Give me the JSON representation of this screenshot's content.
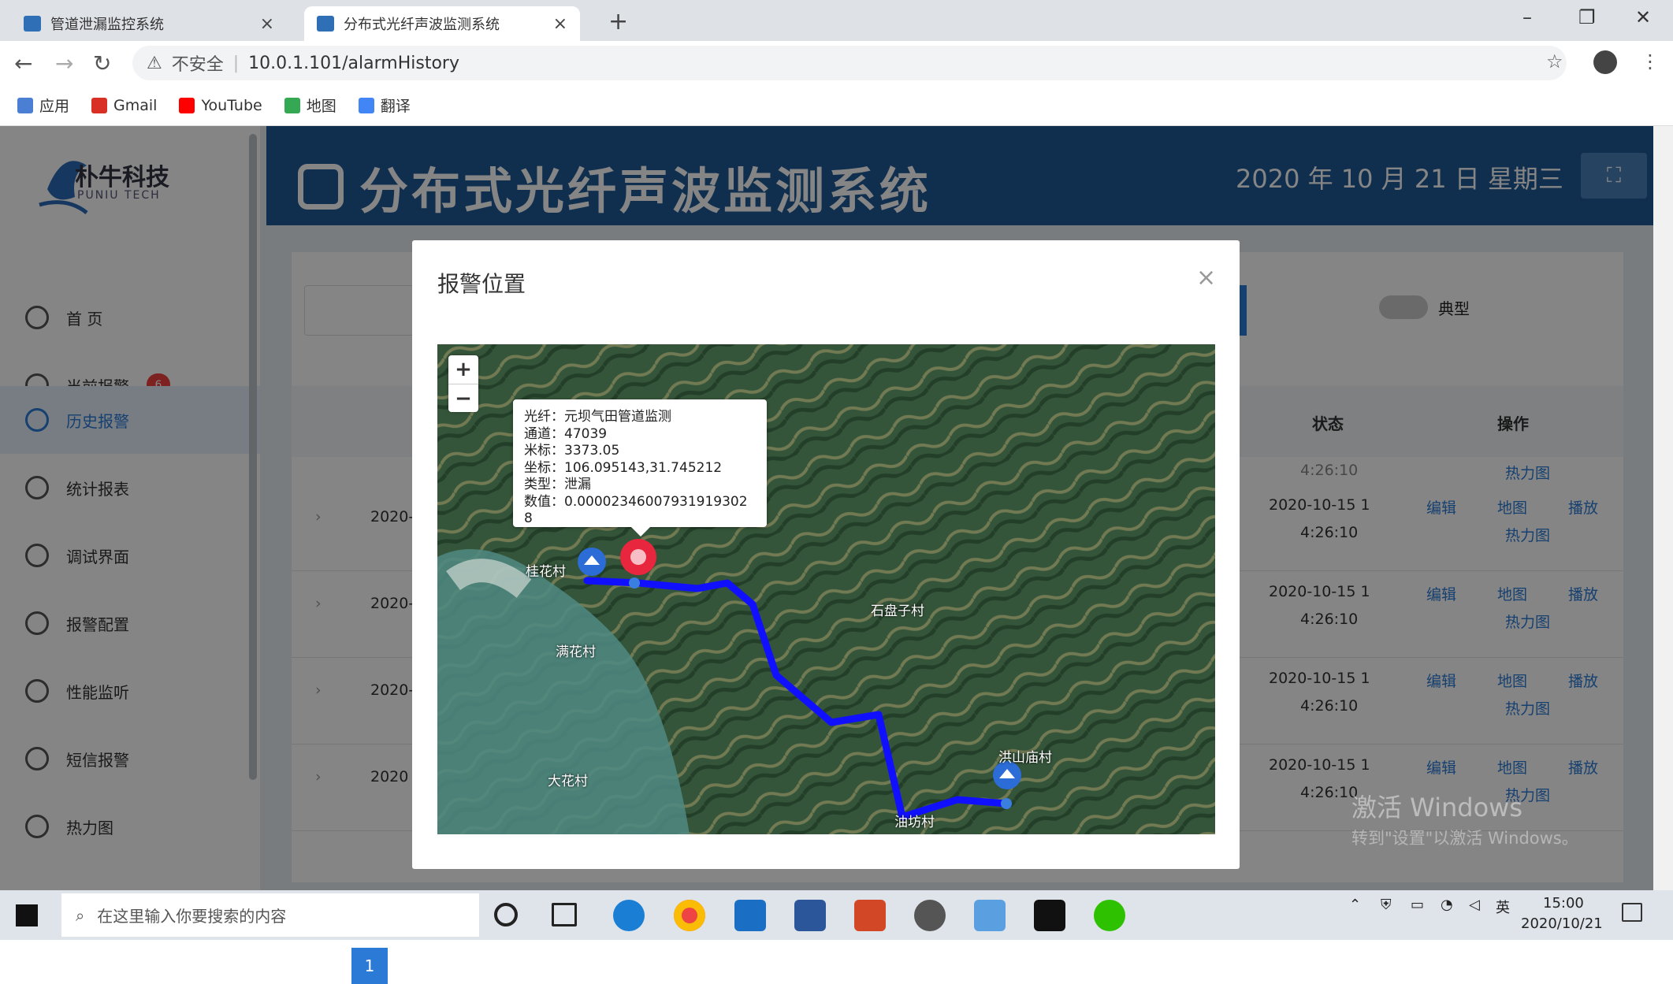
{
  "browser": {
    "tabs": [
      {
        "title": "管道泄漏监控系统",
        "active": false
      },
      {
        "title": "分布式光纤声波监测系统",
        "active": true
      }
    ],
    "insecure_label": "不安全",
    "url": "10.0.1.101/alarmHistory",
    "bookmarks": [
      "应用",
      "Gmail",
      "YouTube",
      "地图",
      "翻译"
    ]
  },
  "app": {
    "logo_name": "朴牛科技",
    "logo_sub": "PUNIU TECH",
    "title": "分布式光纤声波监测系统",
    "date": "2020 年 10 月 21 日 星期三",
    "menu": [
      {
        "label": "首 页",
        "icon": "home-icon"
      },
      {
        "label": "当前报警",
        "icon": "bell-icon",
        "badge": "6"
      },
      {
        "label": "历史报警",
        "icon": "clock-icon",
        "active": true
      },
      {
        "label": "统计报表",
        "icon": "clock-icon"
      },
      {
        "label": "调试界面",
        "icon": "sliders-icon"
      },
      {
        "label": "报警配置",
        "icon": "settings-icon"
      },
      {
        "label": "性能监听",
        "icon": "monitor-icon"
      },
      {
        "label": "短信报警",
        "icon": "mail-icon"
      },
      {
        "label": "热力图",
        "icon": "heatmap-icon"
      }
    ],
    "toggle_label": "典型",
    "table": {
      "headers": {
        "status": "状态",
        "ops": "操作"
      },
      "partial_top": {
        "time": "4:26:10",
        "op": "热力图"
      },
      "rows": [
        {
          "date": "2020-",
          "status_l1": "2020-10-15 1",
          "status_l2": "4:26:10",
          "edit": "编辑",
          "map": "地图",
          "play": "播放",
          "heat": "热力图"
        },
        {
          "date": "2020-",
          "status_l1": "2020-10-15 1",
          "status_l2": "4:26:10",
          "edit": "编辑",
          "map": "地图",
          "play": "播放",
          "heat": "热力图"
        },
        {
          "date": "2020-",
          "status_l1": "2020-10-15 1",
          "status_l2": "4:26:10",
          "edit": "编辑",
          "map": "地图",
          "play": "播放",
          "heat": "热力图"
        },
        {
          "date": "2020",
          "status_l1": "2020-10-15 1",
          "status_l2": "4:26:10",
          "edit": "编辑",
          "map": "地图",
          "play": "播放",
          "heat": "热力图"
        }
      ]
    },
    "pager": "1"
  },
  "modal": {
    "title": "报警位置",
    "close": "×",
    "popup": [
      "光纤：元坝气田管道监测",
      "通道：47039",
      "米标：3373.05",
      "坐标：106.095143,31.745212",
      "类型：泄漏",
      "数值：0.00002346007931919302​8"
    ],
    "map_labels": [
      "桂花村",
      "石盘子村",
      "满花村",
      "洪山庙村",
      "大花村",
      "油坊村"
    ]
  },
  "watermark": {
    "line1": "激活 Windows",
    "line2": "转到\"设置\"以激活 Windows。"
  },
  "taskbar": {
    "search_placeholder": "在这里输入你要搜索的内容",
    "time": "15:00",
    "date": "2020/10/21",
    "ime": "英"
  }
}
